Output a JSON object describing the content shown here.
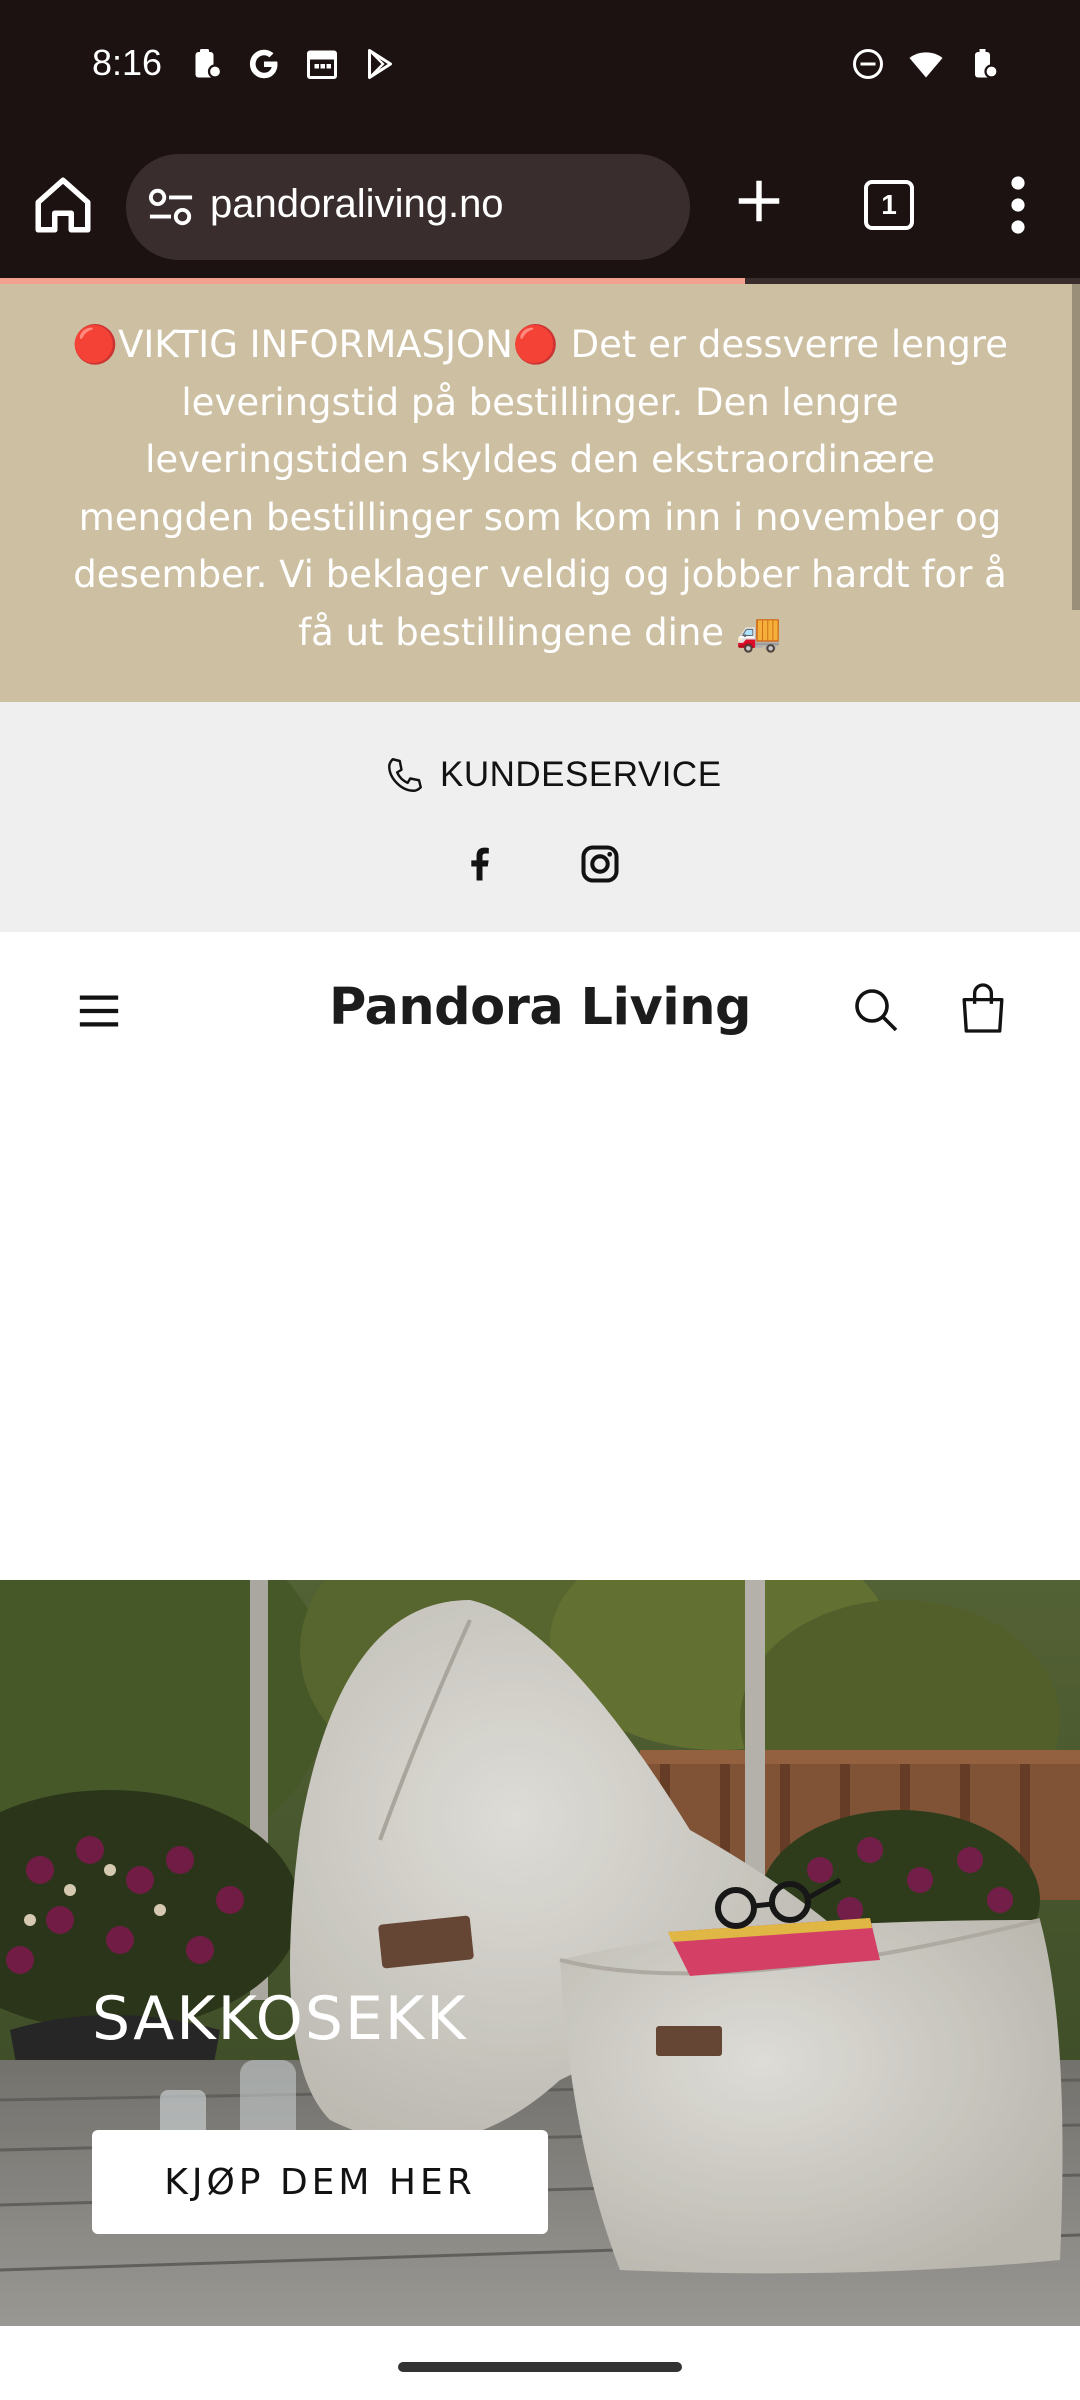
{
  "status_bar": {
    "time": "8:16",
    "left_icons": [
      "clipboard-icon",
      "google-icon",
      "calendar-icon",
      "play-store-icon"
    ],
    "right_icons": [
      "dnd-icon",
      "wifi-icon",
      "battery-icon"
    ]
  },
  "browser": {
    "url": "pandoraliving.no",
    "tab_count": "1",
    "page_load_progress": 0.69
  },
  "announcement": {
    "text": "🔴VIKTIG INFORMASJON🔴 Det er dessverre lengre leveringstid på bestillinger. Den lengre leveringstiden skyldes den ekstraordinære mengden bestillinger som kom inn i november og desember. Vi beklager veldig og jobber hardt for å få ut bestillingene dine 🚚",
    "background": "#cdbfa1"
  },
  "topbar": {
    "customer_service": "KUNDESERVICE",
    "socials": [
      "facebook-icon",
      "instagram-icon"
    ]
  },
  "header": {
    "logo": "Pandora Living"
  },
  "hero": {
    "title": "SAKKOSEKK",
    "button": "KJØP DEM HER"
  }
}
